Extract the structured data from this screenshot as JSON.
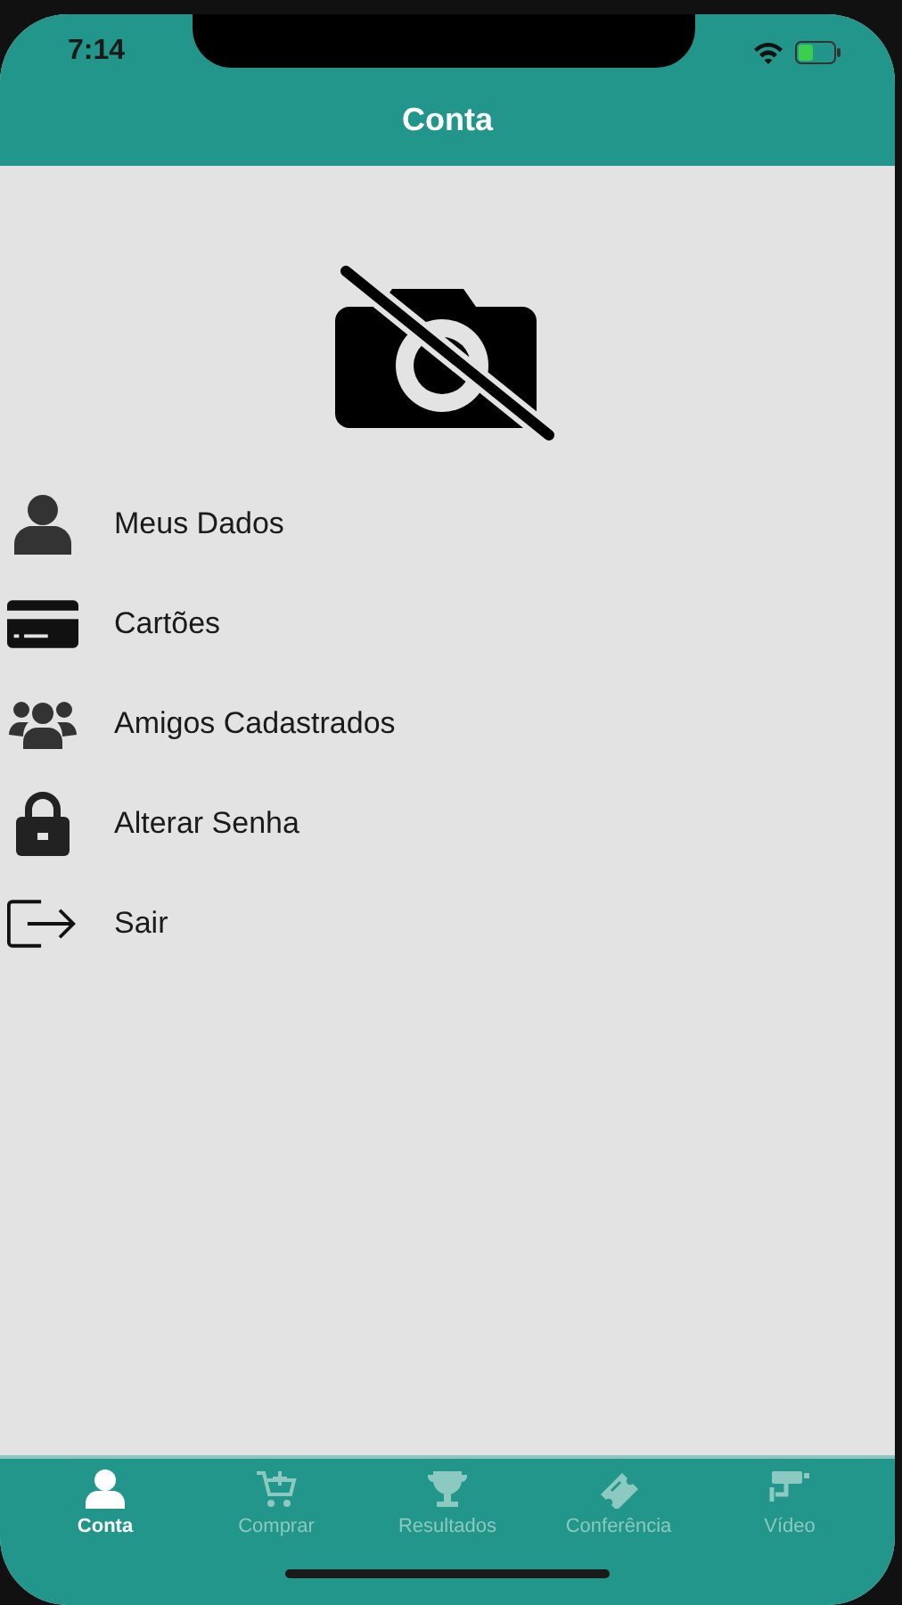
{
  "status_bar": {
    "time": "7:14"
  },
  "header": {
    "title": "Conta"
  },
  "menu": [
    {
      "kind": "user",
      "label": "Meus Dados"
    },
    {
      "kind": "card",
      "label": "Cartões"
    },
    {
      "kind": "group",
      "label": "Amigos Cadastrados"
    },
    {
      "kind": "lock",
      "label": "Alterar Senha"
    },
    {
      "kind": "exit",
      "label": "Sair"
    }
  ],
  "tabs": [
    {
      "kind": "user",
      "label": "Conta",
      "selected": true
    },
    {
      "kind": "cart",
      "label": "Comprar",
      "selected": false
    },
    {
      "kind": "trophy",
      "label": "Resultados",
      "selected": false
    },
    {
      "kind": "ticket",
      "label": "Conferência",
      "selected": false
    },
    {
      "kind": "camera",
      "label": "Vídeo",
      "selected": false
    }
  ]
}
